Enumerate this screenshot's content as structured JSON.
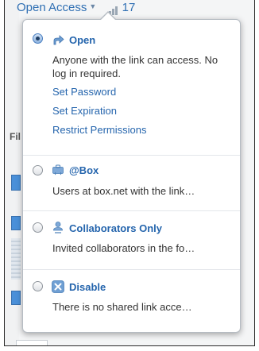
{
  "background": {
    "top_label": "Open Access",
    "count": "17",
    "section_fragment": "Fil"
  },
  "popover": {
    "options": [
      {
        "title": "Open",
        "description": "Anyone with the link can access. No log in required.",
        "selected": true,
        "icon": "open-share-icon",
        "links": [
          "Set Password",
          "Set Expiration",
          "Restrict Permissions"
        ]
      },
      {
        "title": "@Box",
        "description": "Users at box.net with the link…",
        "selected": false,
        "icon": "company-briefcase-icon"
      },
      {
        "title": "Collaborators Only",
        "description": "Invited collaborators in the fo…",
        "selected": false,
        "icon": "collaborators-person-icon"
      },
      {
        "title": "Disable",
        "description": "There is no shared link acce…",
        "selected": false,
        "icon": "disable-x-icon"
      }
    ]
  },
  "colors": {
    "link_blue": "#2565ad",
    "text": "#333333",
    "icon_blue": "#6f9fd3"
  }
}
